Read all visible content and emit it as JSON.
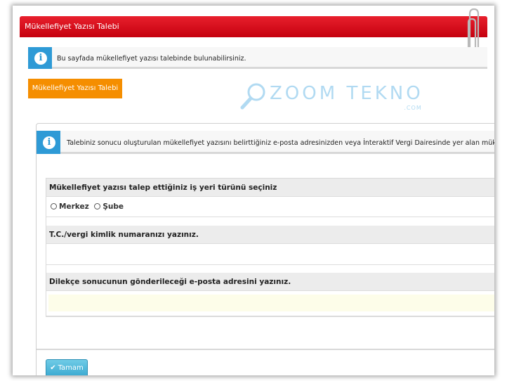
{
  "window": {
    "title": "Mükellefiyet Yazısı Talebi"
  },
  "top_info": {
    "text": "Bu sayfada mükellefiyet yazısı talebinde bulunabilirsiniz."
  },
  "tab": {
    "label": "Mükellefiyet Yazısı Talebi",
    "color": "#f58e00"
  },
  "watermark": {
    "text": "ZOOM TEKNO",
    "sub": ".COM"
  },
  "panel": {
    "info_text": "Talebiniz sonucu oluşturulan mükellefiyet yazısını belirttiğiniz e-posta adresinizden veya İnteraktif Vergi Dairesinde yer alan mükellefiyet",
    "questions": {
      "workplace_label": "Mükellefiyet yazısı talep ettiğiniz iş yeri türünü seçiniz",
      "options": [
        "Merkez",
        "Şube"
      ],
      "tax_id_label": "T.C./vergi kimlik numaranızı yazınız.",
      "email_label": "Dilekçe sonucunun gönderileceği e-posta adresini yazınız."
    },
    "submit_label": "Tamam"
  },
  "colors": {
    "title_red": "#d90f1d",
    "info_blue": "#2e9ad6",
    "button_blue": "#3aa9d0"
  }
}
